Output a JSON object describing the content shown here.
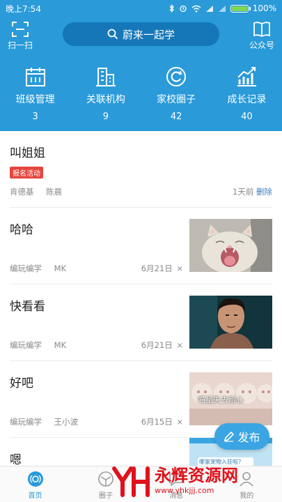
{
  "status_bar": {
    "time": "晚上7:54",
    "battery": "100%",
    "battery_level": 1.0
  },
  "header": {
    "scan_label": "扫一扫",
    "search_text": "蔚来一起学",
    "public_label": "公众号"
  },
  "stats": [
    {
      "icon": "calendar-icon",
      "label": "班级管理",
      "count": "3"
    },
    {
      "icon": "building-icon",
      "label": "关联机构",
      "count": "9"
    },
    {
      "icon": "circle-refresh-icon",
      "label": "家校圈子",
      "count": "42"
    },
    {
      "icon": "growth-chart-icon",
      "label": "成长记录",
      "count": "40"
    }
  ],
  "feed": [
    {
      "title": "叫姐姐",
      "badge": "报名活动",
      "authors": [
        "肯德基",
        "陈晨"
      ],
      "time": "1天前",
      "action": "删除"
    },
    {
      "title": "哈哈",
      "authors": [
        "编玩编学",
        "MK"
      ],
      "time": "6月21日",
      "close": "×",
      "thumb": "yawning-cat-photo"
    },
    {
      "title": "快看看",
      "authors": [
        "编玩编学",
        "MK"
      ],
      "time": "6月21日",
      "close": "×",
      "thumb": "man-portrait-photo"
    },
    {
      "title": "好吧",
      "authors": [
        "编玩编学",
        "王小波"
      ],
      "time": "6月15日",
      "close": "×",
      "thumb": "cats-row-photo",
      "thumb_caption": "喵星失去耐心"
    },
    {
      "title": "嗯",
      "thumb": "blue-banner-photo",
      "thumb_caption": "哪家宠物入驻啦？"
    }
  ],
  "fab": {
    "label": "发布"
  },
  "tabbar": [
    {
      "label": "首页",
      "icon": "home-icon",
      "active": true
    },
    {
      "label": "圈子",
      "icon": "circle-icon",
      "active": false
    },
    {
      "label": "消息",
      "icon": "message-icon",
      "active": false
    },
    {
      "label": "我的",
      "icon": "profile-icon",
      "active": false
    }
  ],
  "watermark": {
    "text": "永辉资源网",
    "url": "www.yhkjjj.com"
  }
}
